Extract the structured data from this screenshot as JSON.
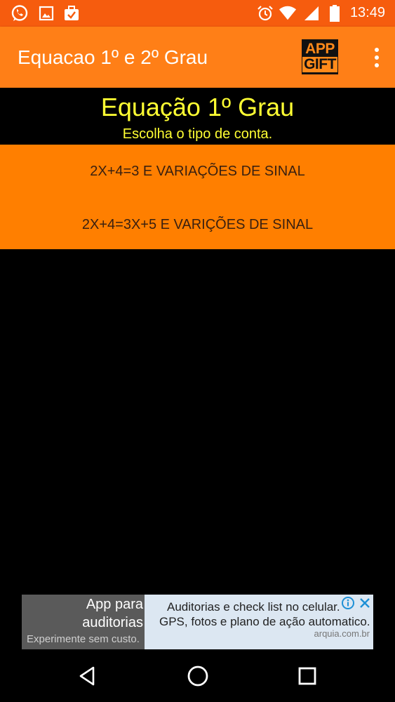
{
  "status_bar": {
    "time": "13:49",
    "left_icons": [
      "whatsapp-icon",
      "image-icon",
      "briefcase-check-icon"
    ],
    "right_icons": [
      "alarm-icon",
      "wifi-icon",
      "cell-signal-icon",
      "battery-icon"
    ],
    "color": "#F65C0E"
  },
  "app_bar": {
    "title": "Equacao 1º e 2º Grau",
    "logo_line1": "APP",
    "logo_line2": "GIFT",
    "color": "#FF7F17"
  },
  "main": {
    "heading": "Equação 1º Grau",
    "subheading": "Escolha o tipo de conta.",
    "heading_color": "#FFFF33",
    "options": [
      {
        "label": "2X+4=3 E VARIAÇÕES DE SINAL"
      },
      {
        "label": "2X+4=3X+5 E VARIÇÕES DE SINAL"
      }
    ],
    "options_color": "#FF7F00"
  },
  "ad": {
    "left_line1": "App para",
    "left_line2": "auditorias",
    "left_line3": "Experimente sem custo.",
    "right_line1": "Auditorias e check list no celular.",
    "right_line2": "GPS, fotos e plano de ação automatico.",
    "right_line3": "arquia.com.br",
    "icons": [
      "info-icon",
      "close-icon"
    ]
  },
  "nav_bar": {
    "buttons": [
      "back-icon",
      "home-icon",
      "recents-icon"
    ]
  }
}
